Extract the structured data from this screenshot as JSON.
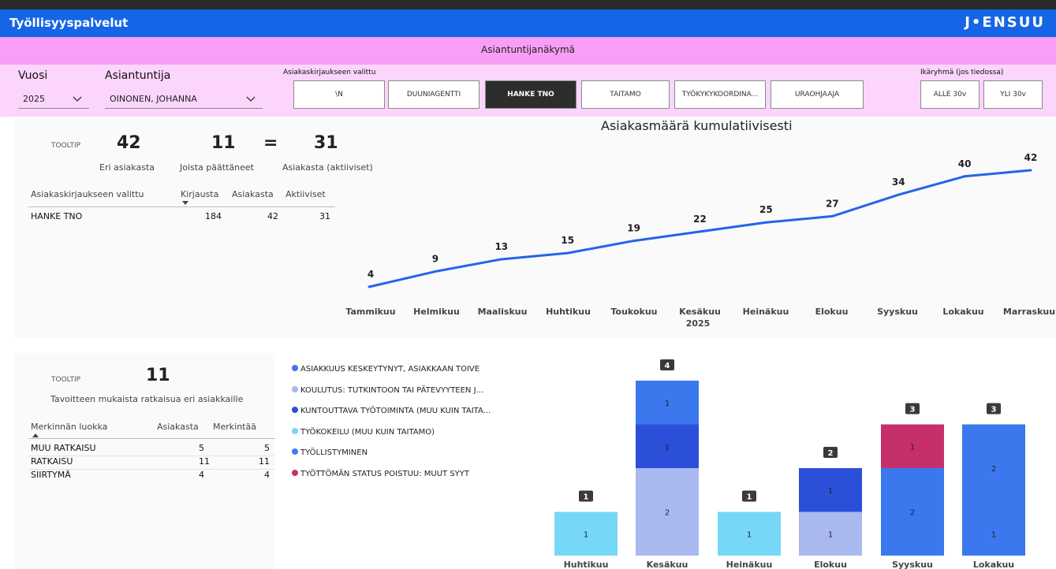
{
  "header": {
    "app_title": "Työllisyyspalvelut",
    "logo_text": "J•ENSUU",
    "view_title": "Asiantuntijanäkymä"
  },
  "colors": {
    "brand_blue": "#1565e6",
    "view_pink": "#f99ef7",
    "filter_pink": "#fbd5fb",
    "line_blue": "#2563eb"
  },
  "filters": {
    "year_label": "Vuosi",
    "year_value": "2025",
    "expert_label": "Asiantuntija",
    "expert_value": "OINONEN, JOHANNA",
    "entry_label": "Asiakaskirjaukseen valittu",
    "entry_options": [
      "\\N",
      "DUUNIAGENTTI",
      "HANKE TNO",
      "TAITAMO",
      "TYÖKYKYKOORDINA...",
      "URAOHJAAJA"
    ],
    "entry_selected": "HANKE TNO",
    "age_label": "Ikäryhmä (jos tiedossa)",
    "age_options": [
      "ALLE 30v",
      "YLI 30v"
    ]
  },
  "summary": {
    "tooltip": "TOOLTIP",
    "total_value": "42",
    "total_label": "Eri asiakasta",
    "ended_value": "11",
    "ended_label": "Joista päättäneet",
    "equals": "=",
    "active_value": "31",
    "active_label": "Asiakasta (aktiiviset)",
    "table": {
      "headers": [
        "Asiakaskirjaukseen valittu",
        "Kirjausta",
        "Asiakasta",
        "Aktiiviset"
      ],
      "rows": [
        [
          "HANKE TNO",
          "184",
          "42",
          "31"
        ]
      ]
    }
  },
  "outcomes": {
    "tooltip": "TOOLTIP",
    "value": "11",
    "label": "Tavoitteen mukaista ratkaisua eri asiakkaille",
    "table": {
      "headers": [
        "Merkinnän luokka",
        "Asiakasta",
        "Merkintää"
      ],
      "rows": [
        [
          "MUU RATKAISU",
          "5",
          "5"
        ],
        [
          "RATKAISU",
          "11",
          "11"
        ],
        [
          "SIIRTYMÄ",
          "4",
          "4"
        ]
      ]
    }
  },
  "chart_data": [
    {
      "type": "line",
      "title": "Asiakasmäärä kumulatiivisesti",
      "x": [
        "Tammikuu",
        "Helmikuu",
        "Maaliskuu",
        "Huhtikuu",
        "Toukokuu",
        "Kesäkuu",
        "Heinäkuu",
        "Elokuu",
        "Syyskuu",
        "Lokakuu",
        "Marraskuu"
      ],
      "x_group_label": "2025",
      "series": [
        {
          "values": [
            4,
            9,
            13,
            15,
            19,
            22,
            25,
            27,
            34,
            40,
            42
          ],
          "color": "#2563eb"
        }
      ],
      "grid": false,
      "data_labels": true
    },
    {
      "type": "bar",
      "stacked": true,
      "categories": [
        "Huhtikuu",
        "Kesäkuu",
        "Heinäkuu",
        "Elokuu",
        "Syyskuu",
        "Lokakuu"
      ],
      "totals": [
        1,
        4,
        1,
        2,
        3,
        3
      ],
      "legend_position": "top-left",
      "series": [
        {
          "name": "ASIAKKUUS KESKEYTYNYT, ASIAKKAAN TOIVE",
          "color": "#3b78ee",
          "values": [
            0,
            1,
            0,
            0,
            2,
            3
          ]
        },
        {
          "name": "KOULUTUS: TUTKINTOON TAI PÄTEVYYTEEN J...",
          "color": "#aab8f0",
          "values": [
            0,
            2,
            0,
            1,
            0,
            0
          ]
        },
        {
          "name": "KUNTOUTTAVA TYÖTOIMINTA (MUU KUIN TAITA...",
          "color": "#2c4fd9",
          "values": [
            0,
            1,
            0,
            1,
            0,
            0
          ]
        },
        {
          "name": "TYÖKOKEILU (MUU KUIN TAITAMO)",
          "color": "#76d8f6",
          "values": [
            1,
            0,
            1,
            0,
            0,
            0
          ]
        },
        {
          "name": "TYÖLLISTYMINEN",
          "color": "#3e7ef0",
          "values": [
            0,
            0,
            0,
            0,
            0,
            0
          ]
        },
        {
          "name": "TYÖTTÖMÄN STATUS POISTUU: MUUT SYYT",
          "color": "#c5306b",
          "values": [
            0,
            0,
            0,
            0,
            1,
            0
          ]
        }
      ],
      "segment_labels": [
        [
          "1"
        ],
        [
          "2",
          "1",
          "1"
        ],
        [
          "1"
        ],
        [
          "1",
          "1"
        ],
        [
          "2",
          "1"
        ],
        [
          "1",
          "2"
        ]
      ]
    }
  ]
}
